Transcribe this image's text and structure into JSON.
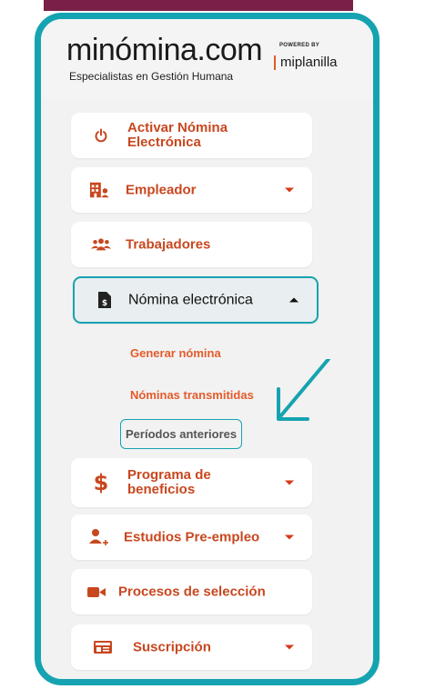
{
  "brand": {
    "logo_text": "minómina.com",
    "tagline": "Especialistas en Gestión Humana",
    "powered_by": "POWERED BY",
    "partner": "miplanilla"
  },
  "menu": {
    "activar": {
      "label": "Activar Nómina Electrónica",
      "icon": "power-icon"
    },
    "empleador": {
      "label": "Empleador",
      "icon": "building-user-icon"
    },
    "trabajadores": {
      "label": "Trabajadores",
      "icon": "users-icon"
    },
    "nomina": {
      "label": "Nómina electrónica",
      "icon": "invoice-dollar-icon"
    },
    "programa": {
      "label": "Programa de beneficios",
      "icon": "dollar-icon"
    },
    "estudios": {
      "label": "Estudios Pre-empleo",
      "icon": "user-plus-icon"
    },
    "procesos": {
      "label": "Procesos de selección",
      "icon": "video-icon"
    },
    "suscripcion": {
      "label": "Suscripción",
      "icon": "id-card-icon"
    }
  },
  "submenu": {
    "generar": "Generar nómina",
    "transmitidas": "Nóminas transmitidas",
    "periodos": "Períodos anteriores"
  },
  "colors": {
    "accent": "#c8471f",
    "highlight": "#15a3b1",
    "brand_bar": "#7a2046"
  }
}
